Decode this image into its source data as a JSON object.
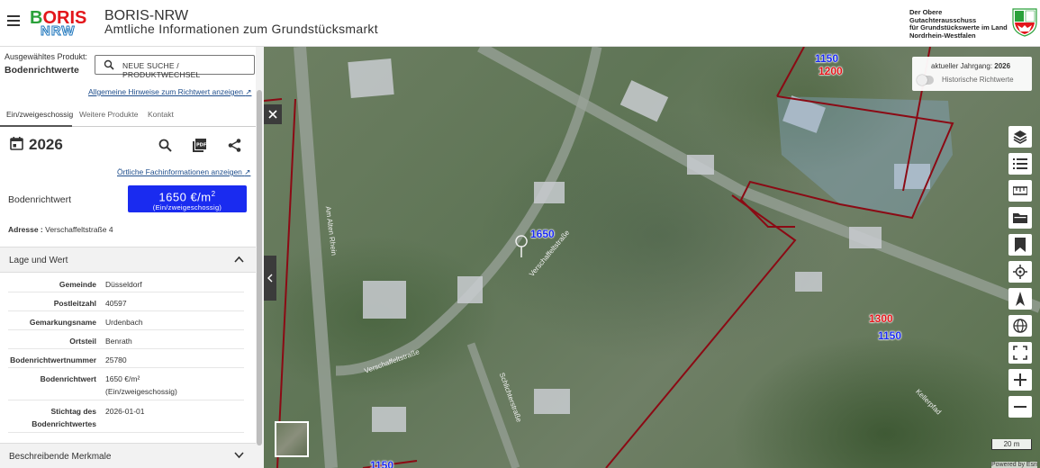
{
  "header": {
    "logo_top": "BORIS",
    "logo_bottom": "NRW",
    "title": "BORIS-NRW",
    "subtitle": "Amtliche Informationen zum Grundstücksmarkt",
    "org_lines": [
      "Der Obere Gutachterausschuss",
      "für Grundstückswerte im Land",
      "Nordrhein-Westfalen"
    ],
    "logo_colors": {
      "green": "#2aa13a",
      "red": "#e3161b",
      "blue": "#1c75bc"
    }
  },
  "panel": {
    "selected_label": "Ausgewähltes Produkt:",
    "selected_value": "Bodenrichtwerte",
    "search_button": "NEUE SUCHE / PRODUKTWECHSEL",
    "hint_link": "Allgemeine Hinweise zum Richtwert anzeigen",
    "tabs": [
      {
        "label": "Ein/zweigeschossig"
      },
      {
        "label": "Weitere Produkte"
      },
      {
        "label": "Kontakt"
      }
    ],
    "year": "2026",
    "local_info_link": "Örtliche Fachinformationen anzeigen",
    "brw_label": "Bodenrichtwert",
    "brw_value": "1650 €/m",
    "brw_sup": "2",
    "brw_sub": "(Ein/zweigeschossig)",
    "address_label": "Adresse :",
    "address_value": "Verschaffeltstraße 4",
    "section_lage": "Lage und Wert",
    "section_merkmale": "Beschreibende Merkmale",
    "attributes": [
      {
        "key": "Gemeinde",
        "value": "Düsseldorf"
      },
      {
        "key": "Postleitzahl",
        "value": "40597"
      },
      {
        "key": "Gemarkungsname",
        "value": "Urdenbach"
      },
      {
        "key": "Ortsteil",
        "value": "Benrath"
      },
      {
        "key": "Bodenrichtwertnummer",
        "value": "25780"
      },
      {
        "key": "Bodenrichtwert",
        "value": "1650 €/m²",
        "value2": "(Ein/zweigeschossig)"
      },
      {
        "key": "Stichtag des",
        "key2": "Bodenrichtwertes",
        "value": "2026-01-01"
      }
    ],
    "brw_color": "#1a2bf0"
  },
  "map": {
    "year_box_label": "aktueller Jahrgang:",
    "year_box_value": "2026",
    "historic_label": "Historische Richtwerte",
    "prices": [
      {
        "text": "1150",
        "color": "#1a2bf0"
      },
      {
        "text": "1200",
        "color": "#e3161b"
      },
      {
        "text": "1650",
        "color": "#1a2bf0"
      },
      {
        "text": "1300",
        "color": "#e3161b"
      },
      {
        "text": "1150",
        "color": "#1a2bf0"
      },
      {
        "text": "1150",
        "color": "#1a2bf0"
      }
    ],
    "streets": [
      "Verschaffeltstraße",
      "Verschaffeltstraße",
      "Schlichterstraße",
      "Am Alten Rhein",
      "Kellerpfad"
    ],
    "scale": "20 m",
    "powered": "Powered by Esri",
    "toolbar": [
      "layers-icon",
      "legend-list-icon",
      "ruler-icon",
      "folder-icon",
      "bookmark-icon",
      "locate-icon",
      "north-arrow-icon",
      "globe-icon",
      "fullscreen-icon",
      "zoom-in-icon",
      "zoom-out-icon"
    ]
  }
}
